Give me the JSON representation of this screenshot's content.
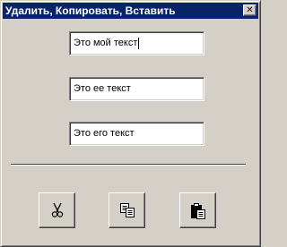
{
  "window": {
    "title": "Удалить, Копировать, Вставить",
    "close_glyph": "✕"
  },
  "textboxes": [
    {
      "value": "Это мой текст"
    },
    {
      "value": "Это ее текст"
    },
    {
      "value": "Это его текст"
    }
  ],
  "toolbar": {
    "buttons": [
      {
        "icon": "scissors-icon"
      },
      {
        "icon": "copy-icon"
      },
      {
        "icon": "paste-icon"
      }
    ]
  },
  "colors": {
    "titlebar": "#0a246a",
    "face": "#d4d0c8"
  }
}
